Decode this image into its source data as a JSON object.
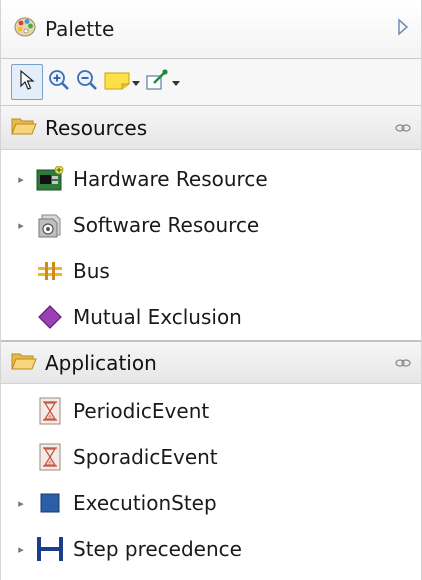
{
  "palette": {
    "title": "Palette",
    "icon": "palette-icon",
    "collapse_icon": "collapse-arrow-icon"
  },
  "toolbar": {
    "tools": [
      {
        "name": "select-tool",
        "icon": "arrow-cursor-icon"
      },
      {
        "name": "zoom-in-tool",
        "icon": "zoom-in-icon"
      },
      {
        "name": "zoom-out-tool",
        "icon": "zoom-out-icon"
      },
      {
        "name": "note-tool",
        "icon": "note-icon"
      },
      {
        "name": "connection-tool",
        "icon": "pin-icon"
      }
    ]
  },
  "drawers": {
    "resources": {
      "label": "Resources",
      "items": [
        {
          "label": "Hardware Resource",
          "expandable": true,
          "icon": "hardware-resource-icon"
        },
        {
          "label": "Software Resource",
          "expandable": true,
          "icon": "software-resource-icon"
        },
        {
          "label": "Bus",
          "expandable": false,
          "icon": "bus-icon"
        },
        {
          "label": "Mutual Exclusion",
          "expandable": false,
          "icon": "mutual-exclusion-icon"
        }
      ]
    },
    "application": {
      "label": "Application",
      "items": [
        {
          "label": "PeriodicEvent",
          "expandable": false,
          "icon": "hourglass-icon"
        },
        {
          "label": "SporadicEvent",
          "expandable": false,
          "icon": "hourglass-icon"
        },
        {
          "label": "ExecutionStep",
          "expandable": true,
          "icon": "execution-step-icon"
        },
        {
          "label": "Step precedence",
          "expandable": true,
          "icon": "step-precedence-icon"
        }
      ]
    }
  },
  "colors": {
    "folder": "#f2c85b",
    "diamond": "#9b3fb5",
    "exec_step": "#2c5ea8",
    "precedence": "#1b3e8a"
  }
}
